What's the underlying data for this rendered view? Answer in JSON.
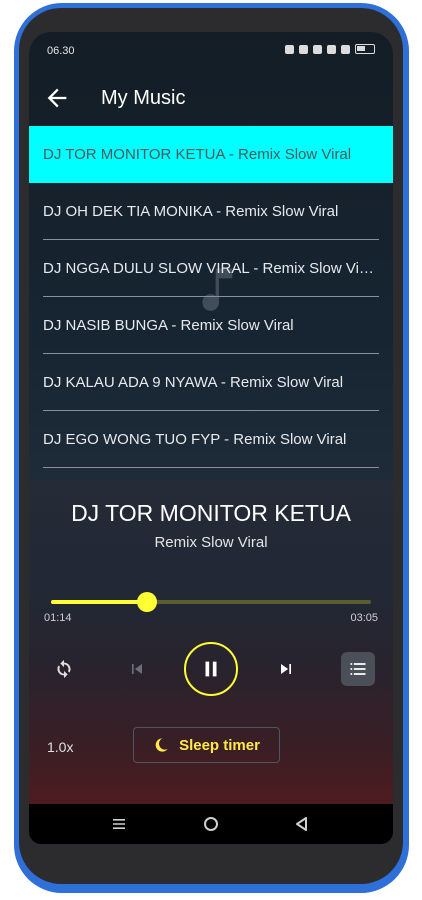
{
  "status_bar": {
    "time": "06.30",
    "icons": [
      "notification-icon",
      "alarm-icon",
      "mute-icon",
      "wifi-icon",
      "signal-icon",
      "battery-icon"
    ]
  },
  "app_bar": {
    "back_icon": "arrow-left-icon",
    "title": "My Music"
  },
  "songs": [
    {
      "title": "DJ TOR MONITOR KETUA - Remix Slow Viral",
      "active": true
    },
    {
      "title": "DJ OH DEK TIA MONIKA - Remix Slow Viral",
      "active": false
    },
    {
      "title": "DJ NGGA DULU SLOW VIRAL - Remix Slow Viral",
      "active": false
    },
    {
      "title": "DJ NASIB BUNGA - Remix Slow Viral",
      "active": false
    },
    {
      "title": "DJ KALAU ADA 9 NYAWA - Remix Slow Viral",
      "active": false
    },
    {
      "title": "DJ EGO WONG TUO FYP - Remix Slow Viral",
      "active": false
    }
  ],
  "player": {
    "title": "DJ TOR MONITOR KETUA",
    "subtitle": "Remix Slow Viral",
    "current_time": "01:14",
    "total_time": "03:05",
    "progress_fraction": 0.3,
    "controls": [
      "repeat-icon",
      "skip-previous-icon",
      "pause-icon",
      "skip-next-icon",
      "queue-list-icon"
    ],
    "speed": "1.0x",
    "sleep_timer_label": "Sleep timer"
  },
  "nav_bar": {
    "buttons": [
      "recents-icon",
      "home-icon",
      "back-triangle-icon"
    ]
  },
  "colors": {
    "accent_cyan": "#00ffff",
    "accent_yellow": "#ffff33",
    "frame_blue": "#2f6fd8"
  }
}
